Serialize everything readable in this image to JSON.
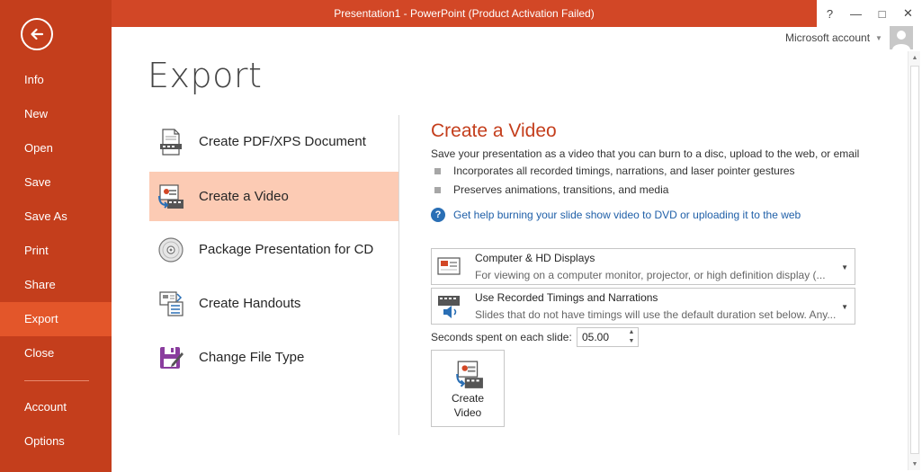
{
  "window": {
    "title": "Presentation1 -  PowerPoint (Product Activation Failed)",
    "help": "?",
    "minimize": "—",
    "maximize": "□",
    "close": "✕"
  },
  "account": {
    "label": "Microsoft account"
  },
  "nav": {
    "items": [
      {
        "label": "Info"
      },
      {
        "label": "New"
      },
      {
        "label": "Open"
      },
      {
        "label": "Save"
      },
      {
        "label": "Save As"
      },
      {
        "label": "Print"
      },
      {
        "label": "Share"
      },
      {
        "label": "Export",
        "active": true
      },
      {
        "label": "Close"
      },
      {
        "label": "Account"
      },
      {
        "label": "Options"
      }
    ]
  },
  "page": {
    "title": "Export"
  },
  "export_options": [
    {
      "label": "Create PDF/XPS Document",
      "icon": "pdf-document-icon"
    },
    {
      "label": "Create a Video",
      "icon": "video-icon",
      "selected": true
    },
    {
      "label": "Package Presentation for CD",
      "icon": "cd-icon"
    },
    {
      "label": "Create Handouts",
      "icon": "handouts-icon"
    },
    {
      "label": "Change File Type",
      "icon": "file-type-icon"
    }
  ],
  "detail": {
    "title": "Create a Video",
    "description": "Save your presentation as a video that you can burn to a disc, upload to the web, or email",
    "bullets": [
      "Incorporates all recorded timings, narrations, and laser pointer gestures",
      "Preserves animations, transitions, and media"
    ],
    "help_link": "Get help burning your slide show video to DVD or uploading it to the web",
    "quality_dropdown": {
      "title": "Computer & HD Displays",
      "subtitle": "For viewing on a computer monitor, projector, or high definition display  (..."
    },
    "timings_dropdown": {
      "title": "Use Recorded Timings and Narrations",
      "subtitle": "Slides that do not have timings will use the default duration set below. Any..."
    },
    "seconds_label": "Seconds spent on each slide:",
    "seconds_value": "05.00",
    "create_button_label": "Create\nVideo"
  },
  "colors": {
    "nav_bg": "#c43e1c",
    "nav_active": "#e3562a",
    "titlebar": "#d24726",
    "selected_option": "#fccbb4",
    "accent_text": "#c43e1c",
    "link": "#1f5fa8"
  }
}
